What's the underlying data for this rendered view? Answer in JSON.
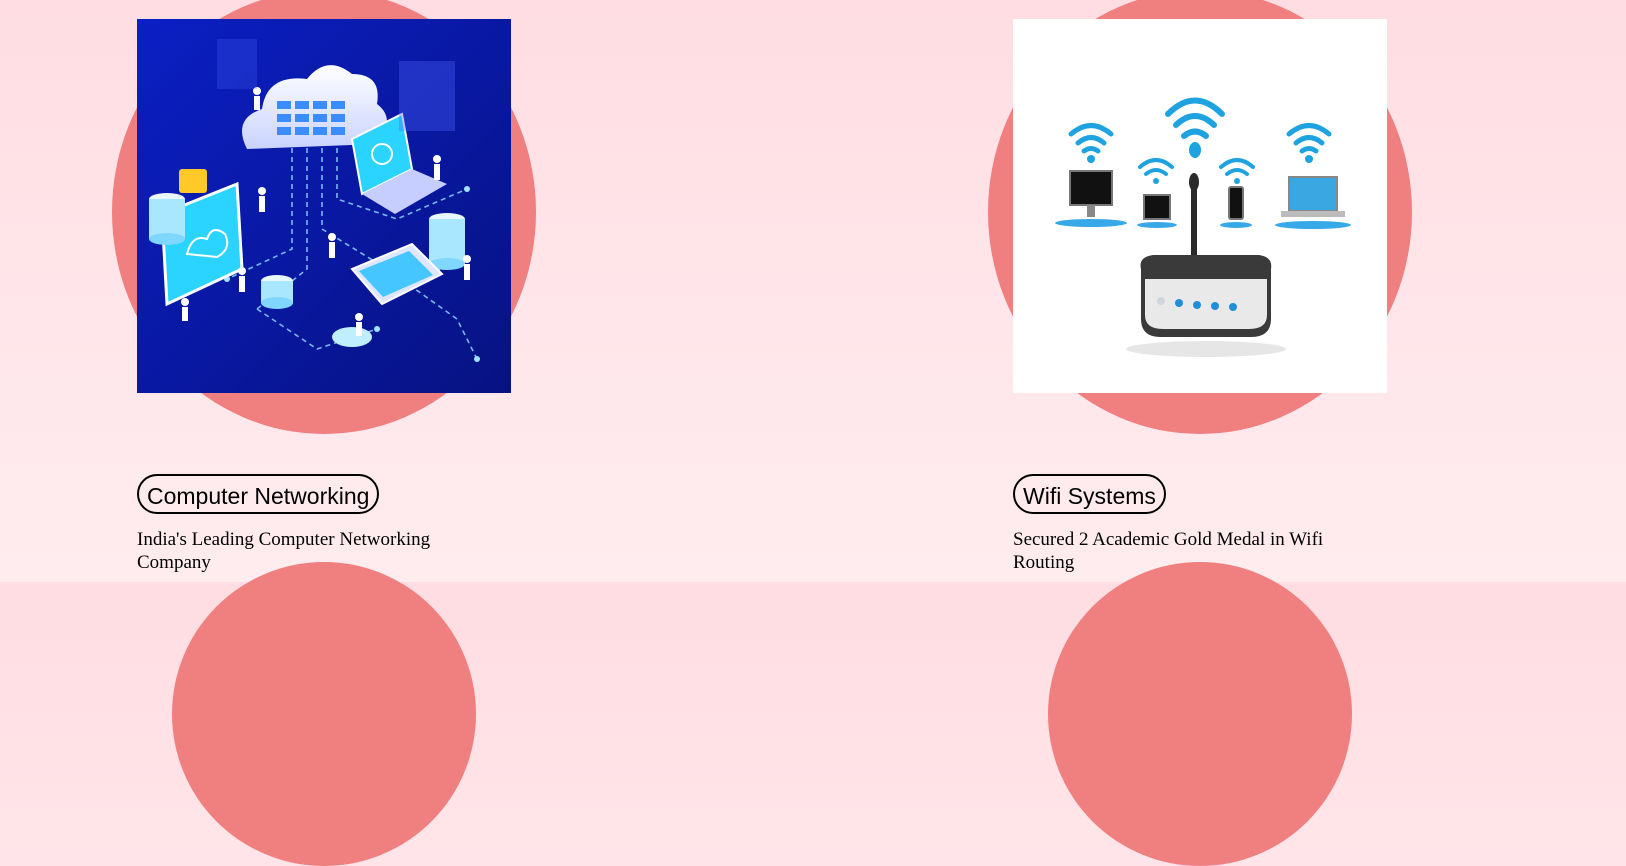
{
  "services": [
    {
      "title": "Computer Networking",
      "description": "India's Leading Computer Networking Company",
      "image_icon": "network-isometric-illustration"
    },
    {
      "title": "Wifi Systems",
      "description": "Secured 2 Academic Gold Medal in Wifi Routing",
      "image_icon": "wifi-router-illustration"
    }
  ],
  "colors": {
    "background": "#ffe2e6",
    "accent_circle": "#f08080",
    "network_image_bg": "#0a1aa8",
    "wifi_blue": "#1fa3e0",
    "text": "#000000"
  }
}
